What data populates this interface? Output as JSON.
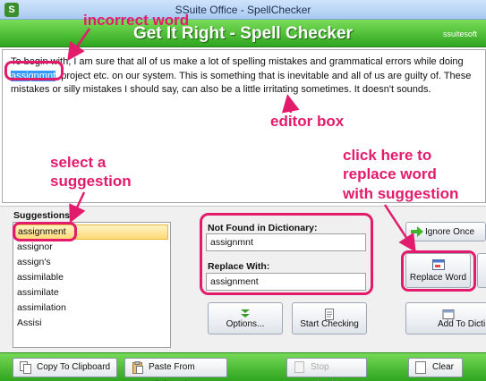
{
  "window": {
    "title": "SSuite Office - SpellChecker",
    "icon_letter": "S"
  },
  "header": {
    "title": "Get It Right - Spell Checker",
    "brand": "ssuitesoft"
  },
  "editor": {
    "text_before": "To begin with, I am sure that all of us make a lot of spelling mistakes and grammatical errors while doing",
    "selected_word": "assignmnt",
    "text_after": ", project etc. on our system. This is something that is inevitable and all of us are guilty of. These mistakes or silly mistakes I should say, can also be a little irritating sometimes. It doesn't sounds."
  },
  "suggestions": {
    "label": "Suggestions:",
    "items": [
      "assignment",
      "assignor",
      "assign's",
      "assimilable",
      "assimilate",
      "assimilation",
      "Assisi"
    ],
    "selected_index": 0
  },
  "not_found": {
    "label": "Not Found in Dictionary:",
    "value": "assignmnt"
  },
  "replace_with": {
    "label": "Replace With:",
    "value": "assignment"
  },
  "buttons": {
    "options": "Options...",
    "start_checking": "Start Checking",
    "ignore_once": "Ignore Once",
    "replace_word": "Replace Word",
    "add_to_dictionary": "Add To Dicti"
  },
  "footer": {
    "copy": "Copy To Clipboard",
    "paste": "Paste From Clipboard",
    "stop": "Stop Checking",
    "clear": "Clear"
  },
  "annotations": {
    "incorrect_word": "incorrect word",
    "editor_box": "editor box",
    "select_suggestion": [
      "select a",
      "suggestion"
    ],
    "replace_hint": [
      "click here to",
      "replace word",
      "with suggestion"
    ],
    "color": "#e31b6d"
  }
}
